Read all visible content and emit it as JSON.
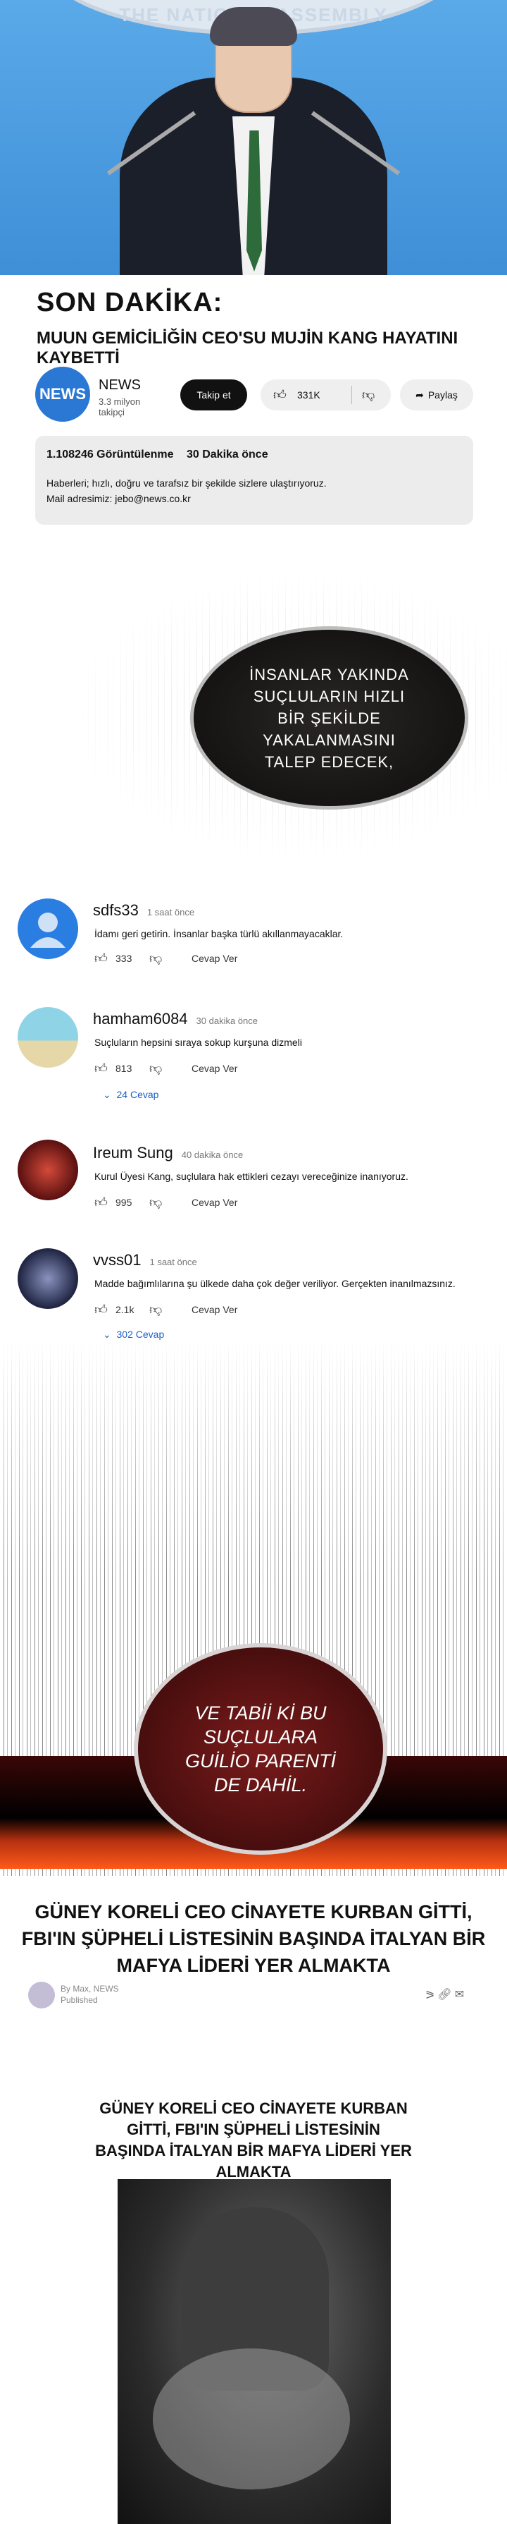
{
  "banner": {
    "seal_text": "THE NATIONAL ASSEMBLY"
  },
  "news": {
    "headline_label": "SON DAKİKA:",
    "headline": "MUUN GEMİCİLİĞİN CEO'SU MUJİN KANG HAYATINI KAYBETTİ",
    "channel": {
      "logo_text": "NEWS",
      "name": "NEWS",
      "subscribers": "3.3 milyon takipçi"
    },
    "follow_label": "Takip et",
    "likes": "331K",
    "share_label": "Paylaş",
    "description": {
      "views": "1.108246 Görüntülenme",
      "time": "30 Dakika önce",
      "line1": "Haberleri; hızlı, doğru ve tarafsız bir şekilde sizlere ulaştırıyoruz.",
      "line2": "Mail adresimiz: jebo@news.co.kr"
    }
  },
  "bubble1": {
    "text": "İNSANLAR YAKINDA SUÇLULARIN HIZLI BİR ŞEKİLDE YAKALANMASINI TALEP EDECEK,"
  },
  "comments": [
    {
      "user": "sdfs33",
      "time": "1 saat önce",
      "text": "İdamı geri getirin. İnsanlar başka türlü akıllanmayacaklar.",
      "likes": "333",
      "reply_label": "Cevap Ver",
      "replies": "",
      "avatar_color": "#2a7de1"
    },
    {
      "user": "hamham6084",
      "time": "30 dakika önce",
      "text": "Suçluların hepsini sıraya sokup kurşuna dizmeli",
      "likes": "813",
      "reply_label": "Cevap Ver",
      "replies": "24 Cevap",
      "avatar_color": "#7ec8d8"
    },
    {
      "user": "Ireum Sung",
      "time": "40 dakika önce",
      "text": "Kurul Üyesi Kang, suçlulara hak ettikleri cezayı vereceğinize inanıyoruz.",
      "likes": "995",
      "reply_label": "Cevap Ver",
      "replies": "",
      "avatar_color": "#7a1f1f"
    },
    {
      "user": "vvss01",
      "time": "1 saat önce",
      "text": "Madde bağımlılarına şu ülkede daha çok değer veriliyor. Gerçekten inanılmazsınız.",
      "likes": "2.1k",
      "reply_label": "Cevap Ver",
      "replies": "302 Cevap",
      "avatar_color": "#2c3350"
    }
  ],
  "bubble2": {
    "text": "VE TABİİ Kİ BU SUÇLULARA GUİLİO PARENTİ DE DAHİL."
  },
  "article": {
    "title": "GÜNEY KORELİ CEO CİNAYETE KURBAN GİTTİ, FBI'IN ŞÜPHELİ LİSTESİNİN BAŞINDA İTALYAN BİR MAFYA LİDERİ YER ALMAKTA",
    "author": "By Max, NEWS",
    "status": "Published",
    "icons": [
      "share-icon",
      "link-icon",
      "mail-icon"
    ],
    "inner_title": "GÜNEY KORELİ CEO CİNAYETE KURBAN GİTTİ, FBI'IN ŞÜPHELİ LİSTESİNİN BAŞINDA İTALYAN BİR MAFYA LİDERİ YER ALMAKTA"
  }
}
